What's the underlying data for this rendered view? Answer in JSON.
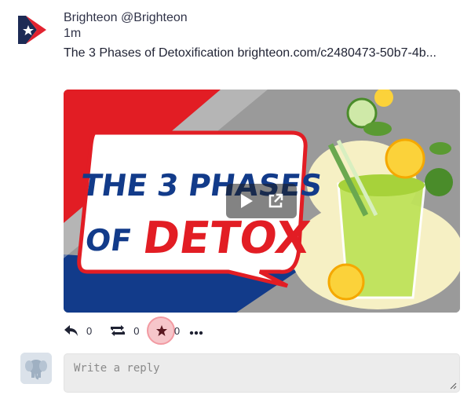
{
  "post": {
    "display_name": "Brighteon",
    "handle": "@Brighteon",
    "time": "1m",
    "status_text": "The 3 Phases of Detoxification brighteon.com/c2480473-50b7-4b...",
    "media": {
      "title_line1": "THE 3 PHASES",
      "title_line2a": "OF",
      "title_line2b": "DETOX"
    }
  },
  "actions": {
    "reply_count": "0",
    "boost_count": "0",
    "favourite_count": "0"
  },
  "reply": {
    "placeholder": "Write a reply"
  },
  "colors": {
    "favourite_highlight": "#f6c6ca",
    "thumbnail_red": "#e21d24",
    "thumbnail_blue": "#123b8a"
  }
}
